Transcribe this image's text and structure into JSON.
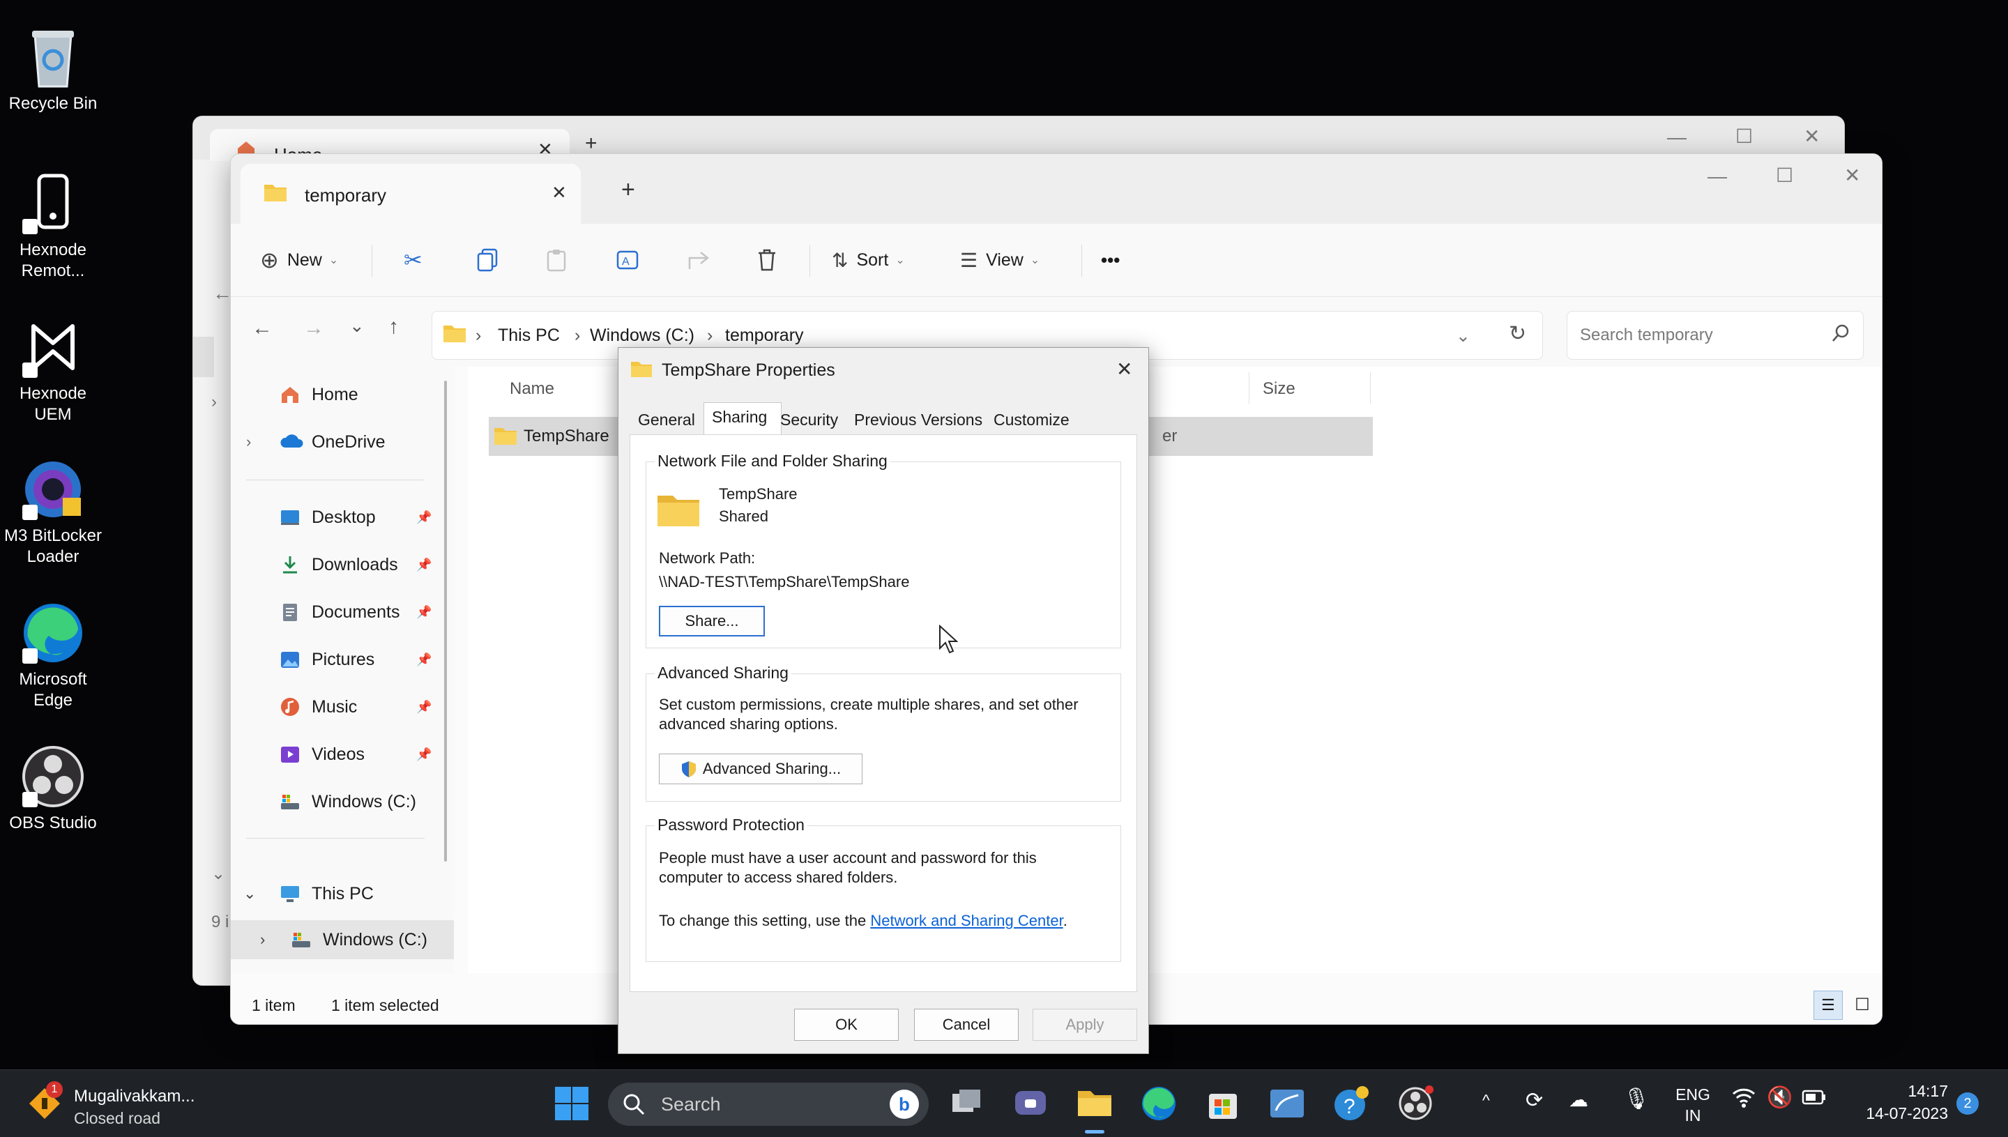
{
  "desktop": {
    "icons": [
      {
        "label": "Recycle Bin",
        "icon": "recycle-bin-icon"
      },
      {
        "label": "Hexnode Remot...",
        "icon": "hexnode-remote-icon"
      },
      {
        "label": "Hexnode UEM",
        "icon": "hexnode-uem-icon"
      },
      {
        "label": "M3 BitLocker Loader",
        "icon": "m3-bitlocker-icon"
      },
      {
        "label": "Microsoft Edge",
        "icon": "edge-icon"
      },
      {
        "label": "OBS Studio",
        "icon": "obs-icon"
      }
    ]
  },
  "back_window": {
    "tab_title": "Home",
    "status_partial": "9 i"
  },
  "explorer": {
    "tab_title": "temporary",
    "toolbar": {
      "new_label": "New",
      "sort_label": "Sort",
      "view_label": "View",
      "more_label": "•••"
    },
    "breadcrumb": [
      "This PC",
      "Windows (C:)",
      "temporary"
    ],
    "search_placeholder": "Search temporary",
    "nav": {
      "home": "Home",
      "onedrive": "OneDrive",
      "quick_access": [
        {
          "label": "Desktop",
          "icon": "desktop-icon",
          "color": "#2b86d8"
        },
        {
          "label": "Downloads",
          "icon": "downloads-icon",
          "color": "#1e8a4c"
        },
        {
          "label": "Documents",
          "icon": "documents-icon",
          "color": "#7a8594"
        },
        {
          "label": "Pictures",
          "icon": "pictures-icon",
          "color": "#2e79d6"
        },
        {
          "label": "Music",
          "icon": "music-icon",
          "color": "#e0603c"
        },
        {
          "label": "Videos",
          "icon": "videos-icon",
          "color": "#7a3fd1"
        },
        {
          "label": "Windows (C:)",
          "icon": "drive-icon",
          "color": "#5c6b7a"
        }
      ],
      "this_pc": "This PC",
      "windows_c": "Windows (C:)"
    },
    "columns": {
      "name": "Name",
      "size": "Size"
    },
    "rows": [
      {
        "name": "TempShare",
        "type_partial": "er"
      }
    ],
    "status": {
      "count": "1 item",
      "selected": "1 item selected"
    }
  },
  "dialog": {
    "title": "TempShare Properties",
    "tabs": [
      "General",
      "Sharing",
      "Security",
      "Previous Versions",
      "Customize"
    ],
    "active_tab": "Sharing",
    "network_sharing": {
      "group_title": "Network File and Folder Sharing",
      "folder_name": "TempShare",
      "folder_state": "Shared",
      "network_path_label": "Network Path:",
      "network_path": "\\\\NAD-TEST\\TempShare\\TempShare",
      "share_button": "Share..."
    },
    "advanced": {
      "group_title": "Advanced Sharing",
      "description": "Set custom permissions, create multiple shares, and set other advanced sharing options.",
      "button": "Advanced Sharing..."
    },
    "password": {
      "group_title": "Password Protection",
      "description": "People must have a user account and password for this computer to access shared folders.",
      "change_text": "To change this setting, use the",
      "link": "Network and Sharing Center",
      "link_suffix": "."
    },
    "buttons": {
      "ok": "OK",
      "cancel": "Cancel",
      "apply": "Apply"
    }
  },
  "taskbar": {
    "weather_title": "Mugalivakkam...",
    "weather_sub": "Closed road",
    "weather_badge": "1",
    "search_label": "Search",
    "lang_top": "ENG",
    "lang_bottom": "IN",
    "time": "14:17",
    "date": "14-07-2023",
    "notification_count": "2"
  }
}
